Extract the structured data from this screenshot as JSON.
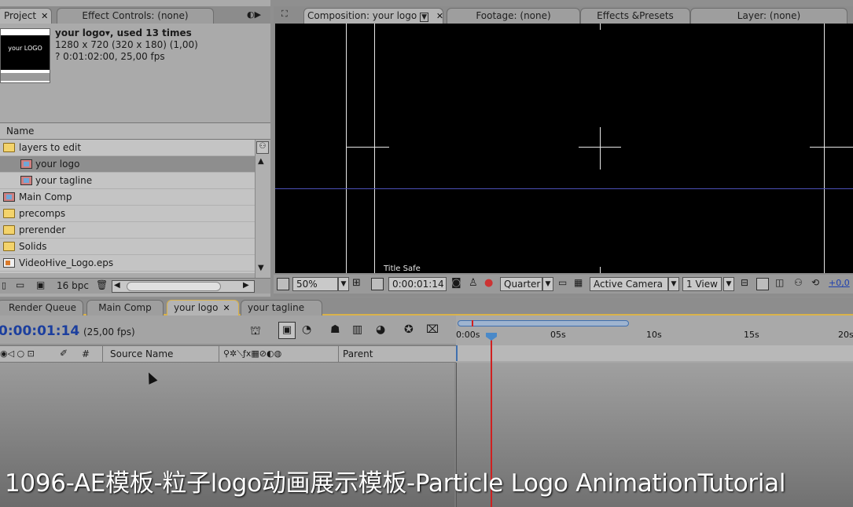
{
  "project_panel": {
    "tab_project": "Project",
    "tab_effect_controls": "Effect Controls: (none)",
    "thumb_text": "your LOGO",
    "info_title": "your logo▾, used 13 times",
    "info_size": "1280 x 720  (320 x 180) (1,00)",
    "info_duration": "? 0:01:02:00, 25,00 fps",
    "name_header": "Name",
    "items": [
      {
        "label": "layers to edit",
        "type": "folder",
        "indent": 0,
        "selected": false
      },
      {
        "label": "your logo",
        "type": "comp",
        "indent": 1,
        "selected": true
      },
      {
        "label": "your tagline",
        "type": "comp",
        "indent": 1,
        "selected": false
      },
      {
        "label": "Main Comp",
        "type": "comp",
        "indent": 0,
        "selected": false
      },
      {
        "label": "precomps",
        "type": "folder",
        "indent": 0,
        "selected": false
      },
      {
        "label": "prerender",
        "type": "folder",
        "indent": 0,
        "selected": false
      },
      {
        "label": "Solids",
        "type": "folder",
        "indent": 0,
        "selected": false
      },
      {
        "label": "VideoHive_Logo.eps",
        "type": "eps",
        "indent": 0,
        "selected": false
      }
    ],
    "bpc": "16 bpc"
  },
  "comp_panel": {
    "tab_composition": "Composition: your logo",
    "tab_footage": "Footage: (none)",
    "tab_effects": "Effects &Presets",
    "tab_layer": "Layer: (none)",
    "title_safe": "Title Safe",
    "zoom": "50%",
    "timecode": "0:00:01:14",
    "resolution": "Quarter",
    "camera": "Active Camera",
    "views": "1 View",
    "exposure": "+0,0"
  },
  "timeline": {
    "tab_render_queue": "Render Queue",
    "tab_main_comp": "Main Comp",
    "tab_your_logo": "your logo",
    "tab_your_tagline": "your tagline",
    "current_time": "0:00:01:14",
    "fps": "(25,00 fps)",
    "col_hash": "#",
    "col_source_name": "Source Name",
    "col_parent": "Parent",
    "ticks": [
      "0:00s",
      "05s",
      "10s",
      "15s",
      "20s"
    ],
    "playhead_seconds": 1.56
  },
  "watermark": "1096-AE模板-粒子logo动画展示模板-Particle Logo AnimationTutorial"
}
